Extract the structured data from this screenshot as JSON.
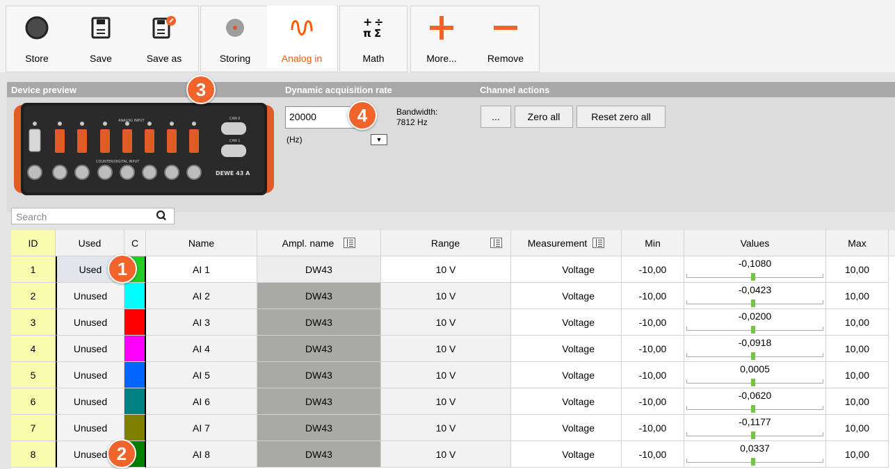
{
  "toolbar": {
    "buttons": [
      {
        "label": "Store",
        "icon": "record-circle-icon"
      },
      {
        "label": "Save",
        "icon": "floppy-icon"
      },
      {
        "label": "Save as",
        "icon": "floppy-edit-icon"
      },
      {
        "label": "Storing",
        "icon": "disk-icon"
      },
      {
        "label": "Analog in",
        "icon": "sine-wave-icon"
      },
      {
        "label": "Math",
        "icon": "math-symbols-icon"
      },
      {
        "label": "More...",
        "icon": "plus-icon"
      },
      {
        "label": "Remove",
        "icon": "minus-icon"
      }
    ],
    "active": "Analog in",
    "accent": "#ff5a00"
  },
  "panel": {
    "device_preview": "Device preview",
    "rate_header": "Dynamic acquisition rate",
    "actions_header": "Channel actions",
    "device": {
      "analog_label": "ANALOG INPUT",
      "counter_label": "COUNTER/DIGITAL INPUT",
      "can0": "CAN 0",
      "can1": "CAN 1",
      "model": "DEWE 43 A"
    },
    "rate_value": "20000",
    "rate_unit": "(Hz)",
    "bandwidth_label": "Bandwidth:",
    "bandwidth_value": "7812 Hz",
    "actions": [
      "...",
      "Zero all",
      "Reset zero all"
    ]
  },
  "search": {
    "placeholder": "Search"
  },
  "table": {
    "headers": [
      "ID",
      "Used",
      "C",
      "Name",
      "Ampl. name",
      "Range",
      "Measurement",
      "Min",
      "Values",
      "Max"
    ],
    "rows": [
      {
        "id": "1",
        "used": "Used",
        "color": "#22cc22",
        "name": "AI 1",
        "ampl": "DW43",
        "range": "10 V",
        "measurement": "Voltage",
        "min": "-10,00",
        "value": "-0,1080",
        "max": "10,00"
      },
      {
        "id": "2",
        "used": "Unused",
        "color": "#00ffff",
        "name": "AI 2",
        "ampl": "DW43",
        "range": "10 V",
        "measurement": "Voltage",
        "min": "-10,00",
        "value": "-0,0423",
        "max": "10,00"
      },
      {
        "id": "3",
        "used": "Unused",
        "color": "#ff0000",
        "name": "AI 3",
        "ampl": "DW43",
        "range": "10 V",
        "measurement": "Voltage",
        "min": "-10,00",
        "value": "-0,0200",
        "max": "10,00"
      },
      {
        "id": "4",
        "used": "Unused",
        "color": "#ff00ff",
        "name": "AI 4",
        "ampl": "DW43",
        "range": "10 V",
        "measurement": "Voltage",
        "min": "-10,00",
        "value": "-0,0918",
        "max": "10,00"
      },
      {
        "id": "5",
        "used": "Unused",
        "color": "#0066ff",
        "name": "AI 5",
        "ampl": "DW43",
        "range": "10 V",
        "measurement": "Voltage",
        "min": "-10,00",
        "value": "0,0005",
        "max": "10,00"
      },
      {
        "id": "6",
        "used": "Unused",
        "color": "#008080",
        "name": "AI 6",
        "ampl": "DW43",
        "range": "10 V",
        "measurement": "Voltage",
        "min": "-10,00",
        "value": "-0,0620",
        "max": "10,00"
      },
      {
        "id": "7",
        "used": "Unused",
        "color": "#808000",
        "name": "AI 7",
        "ampl": "DW43",
        "range": "10 V",
        "measurement": "Voltage",
        "min": "-10,00",
        "value": "-0,1177",
        "max": "10,00"
      },
      {
        "id": "8",
        "used": "Unused",
        "color": "#008000",
        "name": "AI 8",
        "ampl": "DW43",
        "range": "10 V",
        "measurement": "Voltage",
        "min": "-10,00",
        "value": "0,0337",
        "max": "10,00"
      }
    ]
  },
  "callouts": [
    "1",
    "2",
    "3",
    "4"
  ]
}
